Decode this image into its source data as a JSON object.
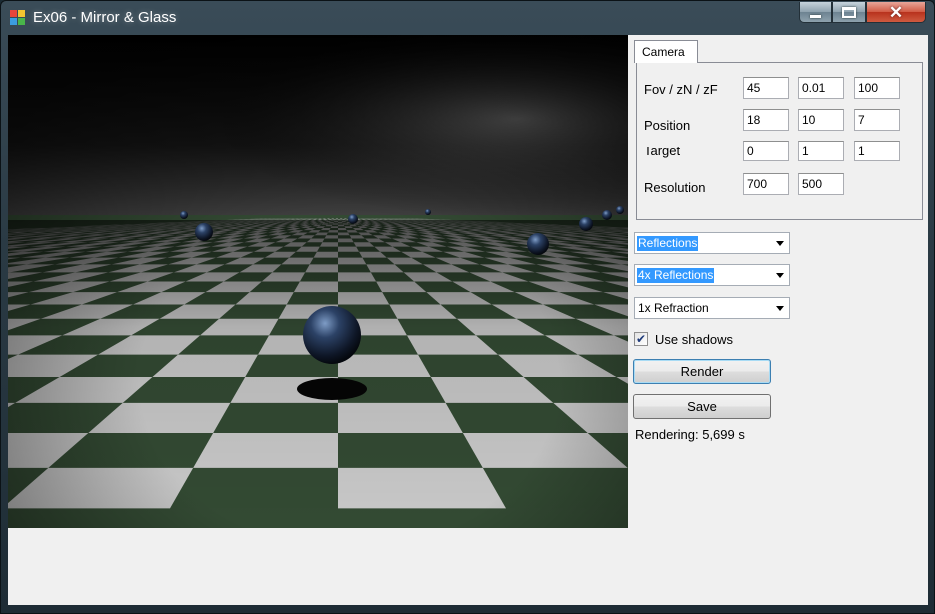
{
  "window": {
    "title": "Ex06 - Mirror & Glass",
    "accent": "#3399ff"
  },
  "title_buttons": {
    "minimize": "minimize-icon",
    "maximize": "maximize-icon",
    "close": "close-icon",
    "close_glyph": "✕"
  },
  "camera_tab": {
    "label": "Camera",
    "fov_label": "Fov / zN / zF",
    "fov": "45",
    "znear": "0.01",
    "zfar": "100",
    "position_label": "Position",
    "pos_x": "18",
    "pos_y": "10",
    "pos_z": "7",
    "target_label": "Target",
    "tgt_x": "0",
    "tgt_y": "1",
    "tgt_z": "1",
    "resolution_label": "Resolution",
    "res_w": "700",
    "res_h": "500"
  },
  "options": {
    "reflections_mode": "Reflections",
    "reflection_depth": "4x Reflections",
    "refraction_depth": "1x Refraction",
    "use_shadows_label": "Use shadows",
    "use_shadows_checked": true,
    "check_glyph": "✔"
  },
  "actions": {
    "render_label": "Render",
    "save_label": "Save"
  },
  "status": {
    "text": "Rendering: 5,699 s"
  }
}
